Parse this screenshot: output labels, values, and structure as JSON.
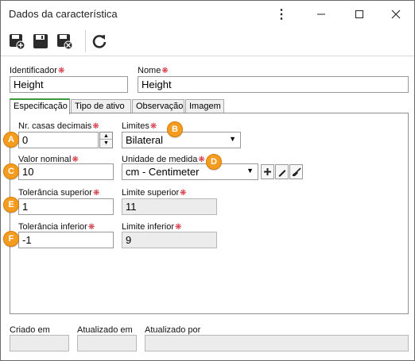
{
  "window": {
    "title": "Dados da característica"
  },
  "toolbar": {
    "icons": [
      "save-new-icon",
      "save-icon",
      "save-close-icon",
      "refresh-icon"
    ]
  },
  "form": {
    "identificador": {
      "label": "Identificador",
      "value": "Height"
    },
    "nome": {
      "label": "Nome",
      "value": "Height"
    }
  },
  "tabs": [
    {
      "label": "Especificação",
      "active": true
    },
    {
      "label": "Tipo de ativo",
      "active": false
    },
    {
      "label": "Observação",
      "active": false
    },
    {
      "label": "Imagem",
      "active": false
    }
  ],
  "spec": {
    "casas_decimais": {
      "label": "Nr. casas decimais",
      "value": "0"
    },
    "limites": {
      "label": "Limites",
      "value": "Bilateral"
    },
    "valor_nominal": {
      "label": "Valor nominal",
      "value": "10"
    },
    "unidade_medida": {
      "label": "Unidade de medida",
      "value": "cm - Centimeter"
    },
    "tol_superior": {
      "label": "Tolerância superior",
      "value": "1"
    },
    "limite_superior": {
      "label": "Limite superior",
      "value": "11"
    },
    "tol_inferior": {
      "label": "Tolerância inferior",
      "value": "-1"
    },
    "limite_inferior": {
      "label": "Limite inferior",
      "value": "9"
    }
  },
  "badges": {
    "a": "A",
    "b": "B",
    "c": "C",
    "d": "D",
    "e": "E",
    "f": "F"
  },
  "footer": {
    "criado_em": {
      "label": "Criado em",
      "value": ""
    },
    "atualizado_em": {
      "label": "Atualizado em",
      "value": ""
    },
    "atualizado_por": {
      "label": "Atualizado por",
      "value": ""
    }
  },
  "colors": {
    "badge": "#f39c1f",
    "required": "#d1202f",
    "tab_active_underline": "#3a9a3a"
  }
}
